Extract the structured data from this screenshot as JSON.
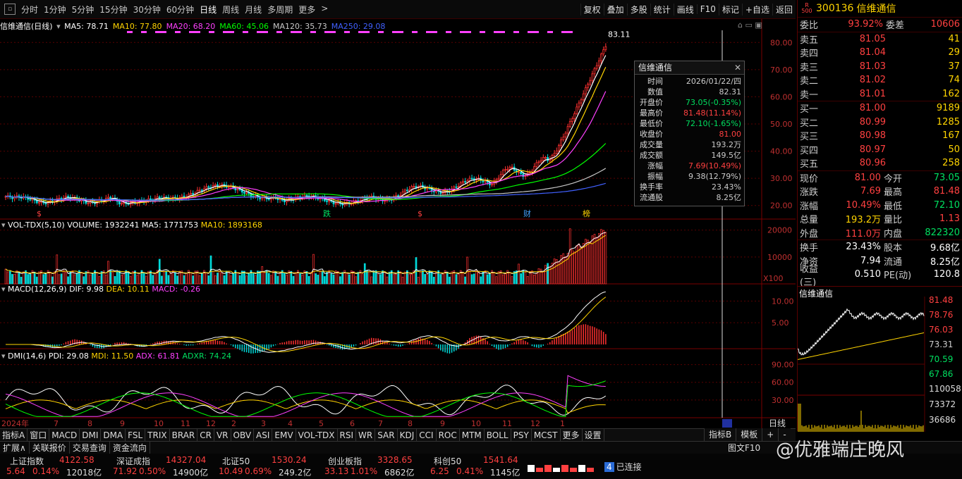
{
  "toolbar": {
    "menu_icon": "menu-square-icon",
    "timeframes": [
      "分时",
      "1分钟",
      "5分钟",
      "15分钟",
      "30分钟",
      "60分钟",
      "日线",
      "周线",
      "月线",
      "多周期",
      "更多"
    ],
    "active_timeframe": "日线",
    "more_arrow": ">",
    "right_buttons": [
      "复权",
      "叠加",
      "多股",
      "统计",
      "画线",
      "F10",
      "标记",
      "+自选",
      "返回"
    ]
  },
  "main_chart": {
    "title": "信维通信(日线)",
    "ma_labels": [
      {
        "text": "MA5: 78.71",
        "color": "#ffffff"
      },
      {
        "text": "MA10: 77.80",
        "color": "#ffd400"
      },
      {
        "text": "MA20: 68.20",
        "color": "#ff40ff"
      },
      {
        "text": "MA60: 45.06",
        "color": "#00ff00"
      },
      {
        "text": "MA120: 35.73",
        "color": "#c8c8c8"
      },
      {
        "text": "MA250: 29.08",
        "color": "#4060ff"
      }
    ],
    "high_label": "83.11",
    "y_ticks": [
      "80.00",
      "70.00",
      "60.00",
      "50.00",
      "40.00",
      "30.00",
      "20.00"
    ],
    "markers": [
      {
        "text": "$",
        "color": "#ff4040"
      },
      {
        "text": "跌",
        "color": "#00e060"
      },
      {
        "text": "$",
        "color": "#ff4040"
      },
      {
        "text": "财",
        "color": "#40a0ff"
      },
      {
        "text": "榜",
        "color": "#ffd400"
      }
    ]
  },
  "tooltip": {
    "title": "信维通信",
    "close": "✕",
    "rows": [
      {
        "k": "时间",
        "v": "2026/01/22/四",
        "c": "#cccccc"
      },
      {
        "k": "数值",
        "v": "82.31",
        "c": "#cccccc"
      },
      {
        "k": "开盘价",
        "v": "73.05(-0.35%)",
        "c": "#00e060"
      },
      {
        "k": "最高价",
        "v": "81.48(11.14%)",
        "c": "#ff4040"
      },
      {
        "k": "最低价",
        "v": "72.10(-1.65%)",
        "c": "#00e060"
      },
      {
        "k": "收盘价",
        "v": "81.00",
        "c": "#ff4040"
      },
      {
        "k": "成交量",
        "v": "193.2万",
        "c": "#cccccc"
      },
      {
        "k": "成交额",
        "v": "149.5亿",
        "c": "#cccccc"
      },
      {
        "k": "涨幅",
        "v": "7.69(10.49%)",
        "c": "#ff4040"
      },
      {
        "k": "振幅",
        "v": "9.38(12.79%)",
        "c": "#cccccc"
      },
      {
        "k": "换手率",
        "v": "23.43%",
        "c": "#cccccc"
      },
      {
        "k": "流通股",
        "v": "8.25亿",
        "c": "#cccccc"
      }
    ]
  },
  "vol_panel": {
    "title_main": "VOL-TDX(5,10) VOLUME: 1932241",
    "ma5": "MA5: 1771753",
    "ma10": "MA10: 1893168",
    "y_ticks": [
      "20000",
      "10000"
    ],
    "unit": "X100"
  },
  "macd_panel": {
    "title_main": "MACD(12,26,9)",
    "dif": "DIF: 9.98",
    "dea": "DEA: 10.11",
    "macd": "MACD: -0.26",
    "y_ticks": [
      "10.00",
      "5.00"
    ]
  },
  "dmi_panel": {
    "title_main": "DMI(14,6)",
    "pdi": "PDI: 29.08",
    "mdi": "MDI: 11.50",
    "adx": "ADX: 61.81",
    "adxr": "ADXR: 74.24",
    "y_ticks": [
      "90.00",
      "60.00",
      "30.00"
    ]
  },
  "x_axis": {
    "labels": [
      "2024年",
      "7",
      "8",
      "9",
      "10",
      "11",
      "12",
      "2",
      "3",
      "4",
      "5",
      "6",
      "7",
      "8",
      "9",
      "10",
      "11",
      "12",
      "1"
    ],
    "right_label": "日线"
  },
  "bottom_tabs": [
    "指标A",
    "窗口",
    "MACD",
    "DMI",
    "DMA",
    "FSL",
    "TRIX",
    "BRAR",
    "CR",
    "VR",
    "OBV",
    "ASI",
    "EMV",
    "VOL-TDX",
    "RSI",
    "WR",
    "SAR",
    "KDJ",
    "CCI",
    "ROC",
    "MTM",
    "BOLL",
    "PSY",
    "MCST",
    "更多",
    "设置"
  ],
  "bottom_right_tabs": [
    "指标B",
    "模板",
    "+",
    "-"
  ],
  "row2_tabs": [
    "扩展∧",
    "关联报价",
    "交易查询",
    "资金流向"
  ],
  "row2_right": "图文F10",
  "quote": {
    "badge": "R\n500",
    "code": "300136",
    "name": "信维通信",
    "weibi_label": "委比",
    "weibi": "93.92%",
    "weicha_label": "委差",
    "weicha": "10606",
    "asks": [
      {
        "n": "卖五",
        "p": "81.05",
        "q": "41"
      },
      {
        "n": "卖四",
        "p": "81.04",
        "q": "29"
      },
      {
        "n": "卖三",
        "p": "81.03",
        "q": "37"
      },
      {
        "n": "卖二",
        "p": "81.02",
        "q": "74"
      },
      {
        "n": "卖一",
        "p": "81.01",
        "q": "162"
      }
    ],
    "bids": [
      {
        "n": "买一",
        "p": "81.00",
        "q": "9189"
      },
      {
        "n": "买二",
        "p": "80.99",
        "q": "1285"
      },
      {
        "n": "买三",
        "p": "80.98",
        "q": "167"
      },
      {
        "n": "买四",
        "p": "80.97",
        "q": "50"
      },
      {
        "n": "买五",
        "p": "80.96",
        "q": "258"
      }
    ],
    "stats": [
      {
        "l1": "现价",
        "v1": "81.00",
        "c1": "#ff4040",
        "l2": "今开",
        "v2": "73.05",
        "c2": "#00e060"
      },
      {
        "l1": "涨跌",
        "v1": "7.69",
        "c1": "#ff4040",
        "l2": "最高",
        "v2": "81.48",
        "c2": "#ff4040"
      },
      {
        "l1": "涨幅",
        "v1": "10.49%",
        "c1": "#ff4040",
        "l2": "最低",
        "v2": "72.10",
        "c2": "#00e060"
      },
      {
        "l1": "总量",
        "v1": "193.2万",
        "c1": "#ffd400",
        "l2": "量比",
        "v2": "1.13",
        "c2": "#ff4040"
      },
      {
        "l1": "外盘",
        "v1": "111.0万",
        "c1": "#ff4040",
        "l2": "内盘",
        "v2": "822320",
        "c2": "#00e060"
      },
      {
        "l1": "换手",
        "v1": "23.43%",
        "c1": "#ffffff",
        "l2": "股本",
        "v2": "9.68亿",
        "c2": "#ffffff"
      },
      {
        "l1": "净资",
        "v1": "7.94",
        "c1": "#ffffff",
        "l2": "流通",
        "v2": "8.25亿",
        "c2": "#ffffff"
      },
      {
        "l1": "收益(三)",
        "v1": "0.510",
        "c1": "#ffffff",
        "l2": "PE(动)",
        "v2": "120.8",
        "c2": "#ffffff"
      }
    ]
  },
  "mini_chart": {
    "title": "信维通信",
    "price_ticks": [
      {
        "t": "81.48",
        "c": "#ff4040"
      },
      {
        "t": "78.76",
        "c": "#ff4040"
      },
      {
        "t": "76.03",
        "c": "#ff4040"
      },
      {
        "t": "73.31",
        "c": "#cccccc"
      },
      {
        "t": "70.59",
        "c": "#00e060"
      },
      {
        "t": "67.86",
        "c": "#00e060"
      }
    ],
    "vol_ticks": [
      "110058",
      "73372",
      "36686"
    ]
  },
  "index_bar": [
    {
      "name": "上证指数",
      "val": "4122.58",
      "chg": "5.64",
      "pct": "0.14%",
      "amt": "12018亿"
    },
    {
      "name": "深证成指",
      "val": "14327.04",
      "chg": "71.92",
      "pct": "0.50%",
      "amt": "14900亿"
    },
    {
      "name": "北证50",
      "val": "1530.24",
      "chg": "10.49",
      "pct": "0.69%",
      "amt": "249.2亿"
    },
    {
      "name": "创业板指",
      "val": "3328.65",
      "chg": "33.13",
      "pct": "1.01%",
      "amt": "6862亿"
    },
    {
      "name": "科创50",
      "val": "1541.64",
      "chg": "6.25",
      "pct": "0.41%",
      "amt": "1145亿"
    }
  ],
  "connection": {
    "num": "4",
    "text": "已连接"
  },
  "watermark": "@优雅端庄晚风",
  "colors": {
    "up": "#ff4040",
    "down": "#00e060",
    "vol": "#ffd400",
    "grid": "#7a0000"
  }
}
